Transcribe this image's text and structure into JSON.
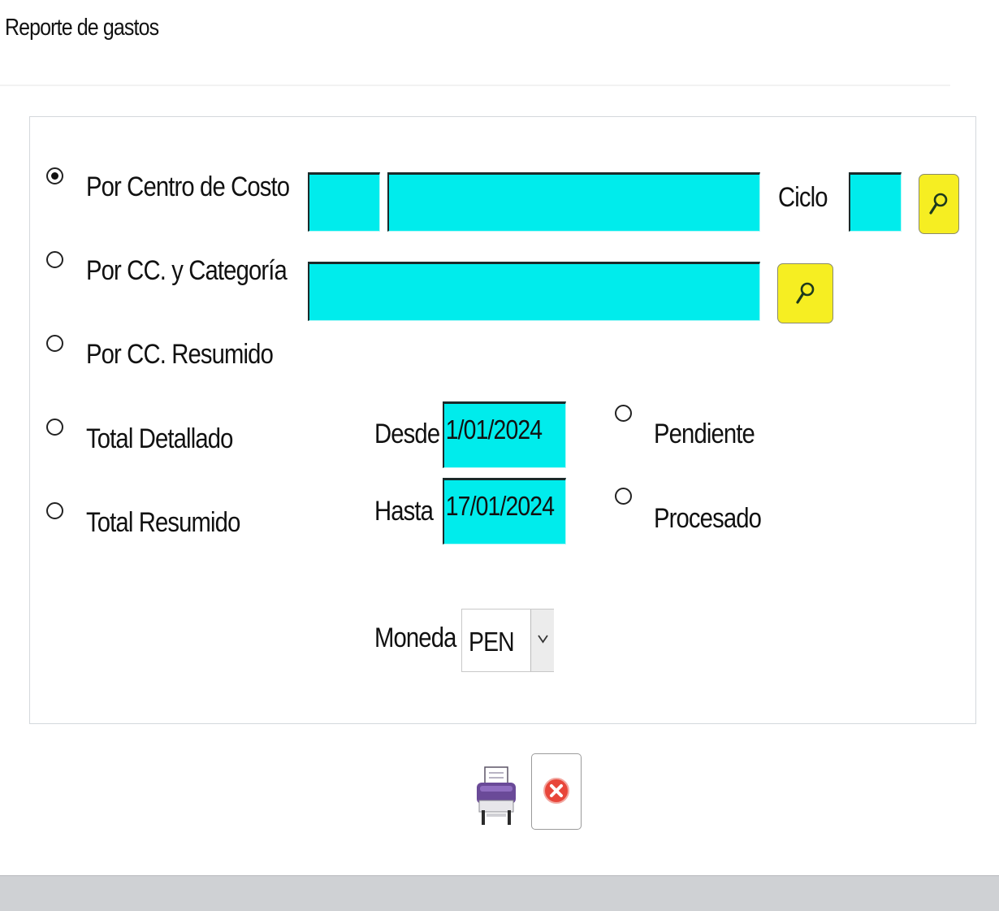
{
  "window": {
    "title": "Reporte de gastos"
  },
  "report_type": {
    "options": [
      {
        "label": "Por Centro de Costo",
        "selected": true
      },
      {
        "label": "Por CC. y Categoría",
        "selected": false
      },
      {
        "label": "Por CC. Resumido",
        "selected": false
      },
      {
        "label": "Total Detallado",
        "selected": false
      },
      {
        "label": "Total Resumido",
        "selected": false
      }
    ]
  },
  "cost_center": {
    "code": "",
    "name": "",
    "search_icon": "magnifier-icon"
  },
  "ciclo": {
    "label": "Ciclo",
    "value": ""
  },
  "category": {
    "name": "",
    "search_icon": "magnifier-icon"
  },
  "dates": {
    "desde_label": "Desde",
    "desde_value": "1/01/2024",
    "hasta_label": "Hasta",
    "hasta_value": "17/01/2024"
  },
  "status": {
    "options": [
      {
        "label": "Pendiente",
        "selected": false
      },
      {
        "label": "Procesado",
        "selected": false
      }
    ]
  },
  "currency": {
    "label": "Moneda",
    "selected": "PEN",
    "arrow_icon": "chevron-down-icon"
  },
  "actions": {
    "print_icon": "printer-icon",
    "close_icon": "close-icon"
  },
  "colors": {
    "input_bg": "#00ecec",
    "search_btn": "#f6ee22",
    "close_red": "#e8463a"
  }
}
